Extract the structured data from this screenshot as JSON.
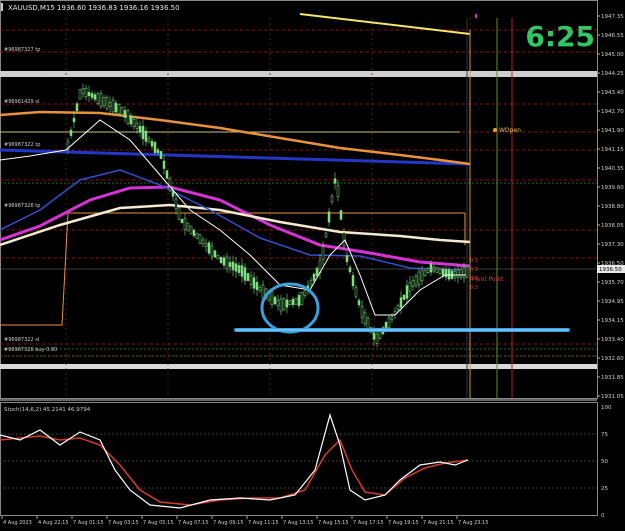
{
  "window": {
    "title": "XAUUSD,M15  1936.60 1936.83 1936.16 1936.50",
    "symbol": "XAUUSD",
    "timeframe": "M15"
  },
  "countdown": "6:25",
  "annotations": {
    "weekly_open": "WOpen",
    "pivot_point": "Pivot Point",
    "order_labels": [
      "#96987327 tp",
      "#96961429 sell 100.00",
      "#96961429 sl",
      "#96987322 tp",
      "#96987326 tp",
      "#96987322 sl",
      "#96987326 buy 0.80"
    ]
  },
  "price_axis": {
    "ticks": [
      "1947.35",
      "1946.55",
      "1945.00",
      "1944.25",
      "1943.40",
      "1942.70",
      "1941.90",
      "1941.15",
      "1940.35",
      "1939.60",
      "1938.80",
      "1938.05",
      "1937.30",
      "1936.50",
      "1935.70",
      "1934.95",
      "1934.15",
      "1933.40",
      "1932.60",
      "1931.85",
      "1931.05"
    ],
    "current_price": "1936.50",
    "current_price_color": "#c0392b"
  },
  "time_axis": {
    "labels": [
      "4 Aug 2023",
      "4 Aug 22:15",
      "7 Aug 01:15",
      "7 Aug 03:15",
      "7 Aug 05:15",
      "7 Aug 07:15",
      "7 Aug 09:15",
      "7 Aug 11:15",
      "7 Aug 13:15",
      "7 Aug 15:15",
      "7 Aug 17:15",
      "7 Aug 19:15",
      "7 Aug 21:15",
      "7 Aug 23:15"
    ]
  },
  "stoch": {
    "label": "Stoch(14,6,2) 45.2141 46.9794",
    "levels": [
      "100",
      "75",
      "50",
      "25",
      "0"
    ],
    "main_color": "#ffffff",
    "signal_color": "#d43c2a"
  },
  "colors": {
    "background": "#000000",
    "candles": "#7ee07e",
    "ma_yellow": "#f5e66a",
    "ma_orange": "#e8933c",
    "ma_blue": "#2236c8",
    "ma_magenta": "#d633d6",
    "ma_cream": "#f3e9d0",
    "ma_white": "#ffffff",
    "annotation_circle": "#3aa0e0",
    "support_line": "#3aa0e0"
  }
}
